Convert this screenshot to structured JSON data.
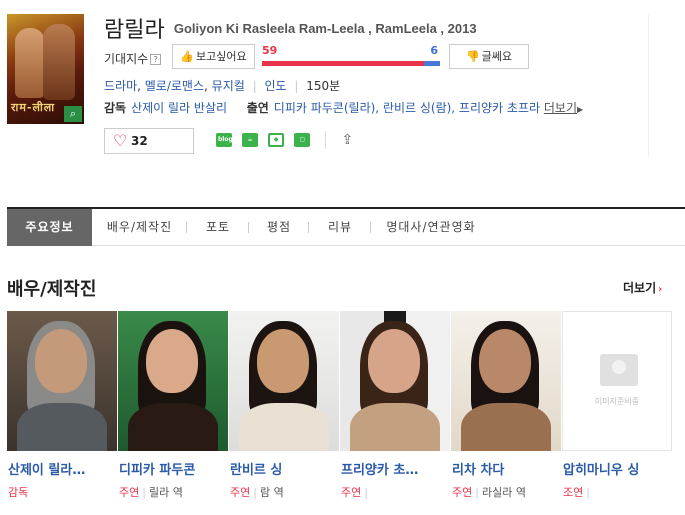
{
  "header": {
    "poster_text": "राम-लीला",
    "title_ko": "람릴라",
    "title_en": "Goliyon Ki Rasleela Ram-Leela , RamLeela , 2013",
    "expect_label": "기대지수",
    "expect_help": "?",
    "want_label": "보고싶어요",
    "meh_label": "글쎄요",
    "want_count": "59",
    "meh_count": "6",
    "want_ratio": 0.908,
    "genres": [
      "드라마",
      "멜로/로맨스",
      "뮤지컬"
    ],
    "country": "인도",
    "runtime": "150분",
    "director_label": "감독",
    "director": "산제이 릴라 반살리",
    "cast_label": "출연",
    "cast_text": "디피카 파두콘(릴라), 란비르 싱(람), 프리양카 초프라",
    "more_label": "더보기",
    "like_count": "32",
    "share_icons": [
      "blog-icon",
      "cafe-icon",
      "bookmark-icon",
      "memo-icon",
      "share-icon"
    ]
  },
  "tabs": [
    {
      "label": "주요정보",
      "active": true
    },
    {
      "label": "배우/제작진",
      "active": false
    },
    {
      "label": "포토",
      "active": false
    },
    {
      "label": "평점",
      "active": false
    },
    {
      "label": "리뷰",
      "active": false
    },
    {
      "label": "명대사/연관영화",
      "active": false
    }
  ],
  "cast_section": {
    "title": "배우/제작진",
    "more_label": "더보기",
    "people": [
      {
        "name": "산제이 릴라…",
        "role": "감독",
        "character": ""
      },
      {
        "name": "디피카 파두콘",
        "role": "주연",
        "character": "릴라 역"
      },
      {
        "name": "란비르 싱",
        "role": "주연",
        "character": "람 역"
      },
      {
        "name": "프리양카 초…",
        "role": "주연",
        "character": ""
      },
      {
        "name": "리차 차다",
        "role": "주연",
        "character": "라실라 역"
      },
      {
        "name": "압히마니우 싱",
        "role": "조연",
        "character": ""
      }
    ],
    "no_image_text": "이미지준비중"
  },
  "colors": {
    "accent_red": "#e8334a",
    "link_blue": "#2a5aa8",
    "gauge_blue": "#4a78d6",
    "tab_active": "#666666"
  }
}
